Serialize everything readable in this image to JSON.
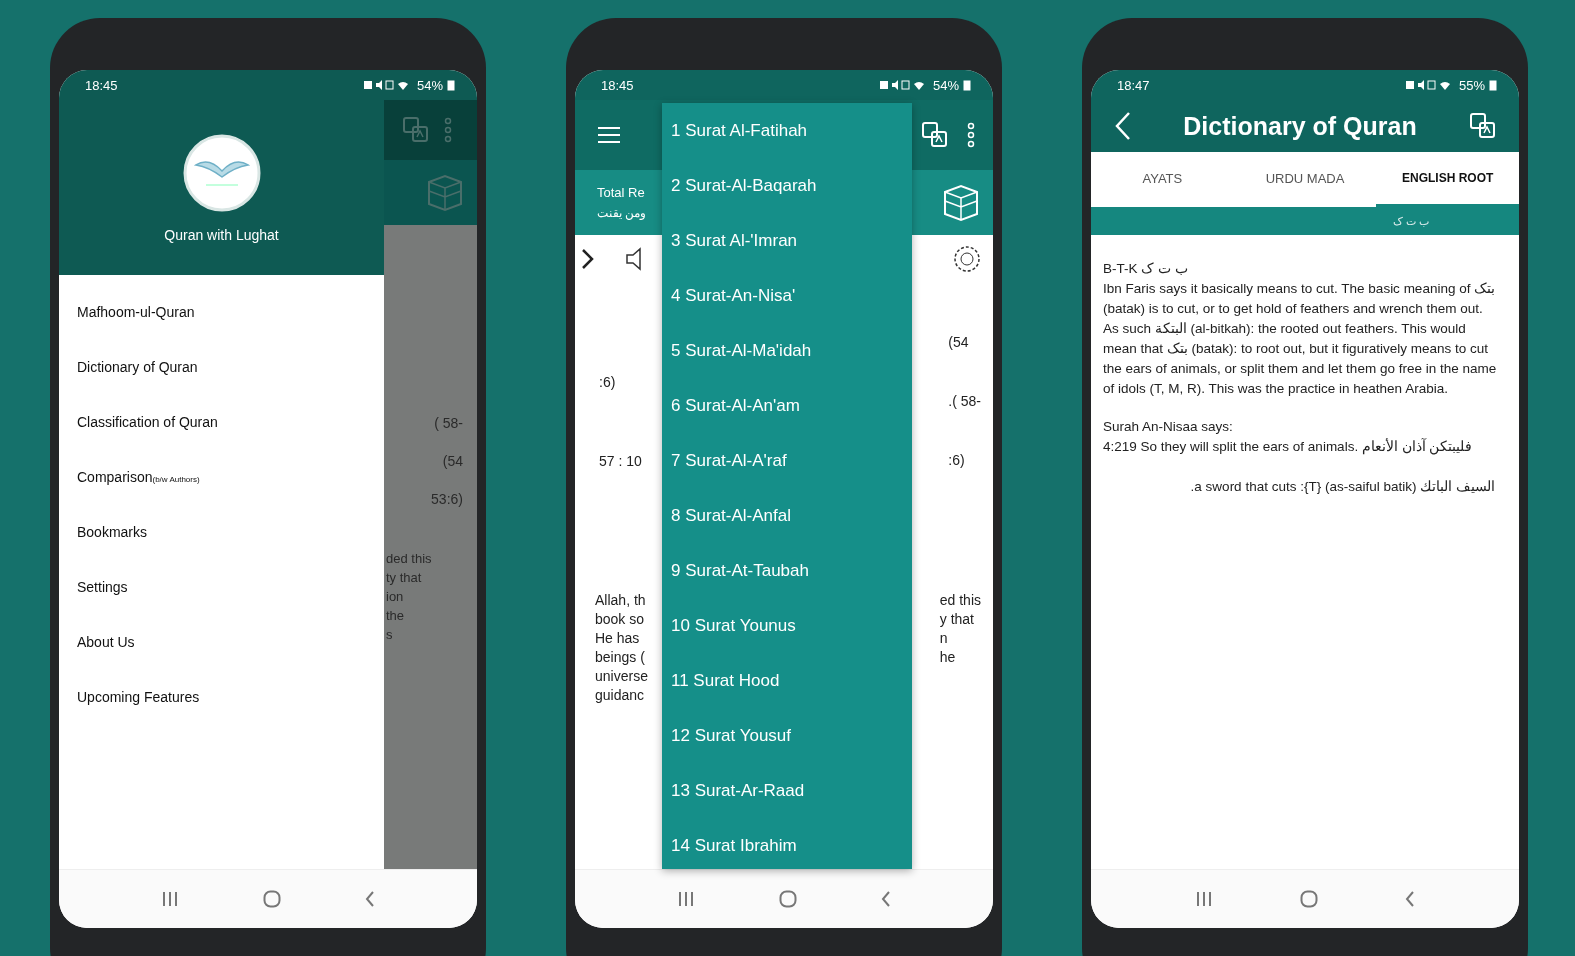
{
  "phones": [
    {
      "kind": "drawer",
      "status_bar": {
        "time": "18:45",
        "battery": "54%"
      },
      "drawer": {
        "app_name": "Quran with Lughat",
        "items": [
          {
            "label": "Mafhoom-ul-Quran"
          },
          {
            "label": "Dictionary of Quran"
          },
          {
            "label": "Classification of Quran"
          },
          {
            "label": "Comparison",
            "note": "(b/w Authors)"
          },
          {
            "label": "Bookmarks"
          },
          {
            "label": "Settings"
          },
          {
            "label": "About Us"
          },
          {
            "label": "Upcoming Features"
          }
        ]
      },
      "behind": {
        "lines": [
          "( 58-",
          "(54",
          "53:6)"
        ],
        "english": [
          "ded this",
          "ty that",
          "ion",
          "the",
          "s"
        ]
      }
    },
    {
      "kind": "surah_menu",
      "status_bar": {
        "time": "18:45",
        "battery": "54%"
      },
      "info_bar": {
        "text": "Total Re",
        "subtext": "ومن يقنت"
      },
      "content": {
        "left": [
          ":6)",
          "57 : 10"
        ],
        "right": [
          "(54",
          ".( 58-",
          ":6)"
        ],
        "english_left": [
          "Allah, th",
          "book so",
          "He has",
          "beings (",
          "universe",
          "guidanc"
        ],
        "english_right": [
          "ed this",
          "y that",
          "n",
          "he"
        ]
      },
      "menu": {
        "items": [
          "1 Surat Al-Fatihah",
          "2 Surat-Al-Baqarah",
          "3 Surat Al-'Imran",
          "4 Surat-An-Nisa'",
          "5 Surat-Al-Ma'idah",
          "6 Surat-Al-An'am",
          "7 Surat-Al-A'raf",
          "8 Surat-Al-Anfal",
          "9 Surat-At-Taubah",
          "10 Surat Younus",
          "11 Surat Hood",
          "12 Surat Yousuf",
          "13 Surat-Ar-Raad",
          "14 Surat Ibrahim"
        ]
      }
    },
    {
      "kind": "dictionary",
      "status_bar": {
        "time": "18:47",
        "battery": "55%"
      },
      "title": "Dictionary of Quran",
      "tabs": [
        {
          "label": "AYATS",
          "selected": false
        },
        {
          "label": "URDU MADA",
          "selected": false
        },
        {
          "label": "ENGLISH ROOT",
          "selected": true
        }
      ],
      "root_bar": "ب ت ک",
      "entry": {
        "heading": "B-T-K ب ت ک",
        "paragraphs": [
          "Ibn Faris says it basically means to cut. The basic meaning of بتک (batak) is to cut, or to get hold of feathers and wrench them out. As such البتکة (al-bitkah): the rooted out feathers. This would mean that بتک (batak): to root out, but it figuratively means to cut the ears of animals, or split them and let them go free in the name of idols (T, M, R). This was the practice in heathen Arabia."
        ],
        "quote_heading": "Surah An-Nisaa says:",
        "quote": "4:219 So they will split the ears of animals. فليبتكن آذان الأنعام",
        "footer": "السيف الباتك (as-saiful batik) {T}: a sword that cuts."
      }
    }
  ]
}
